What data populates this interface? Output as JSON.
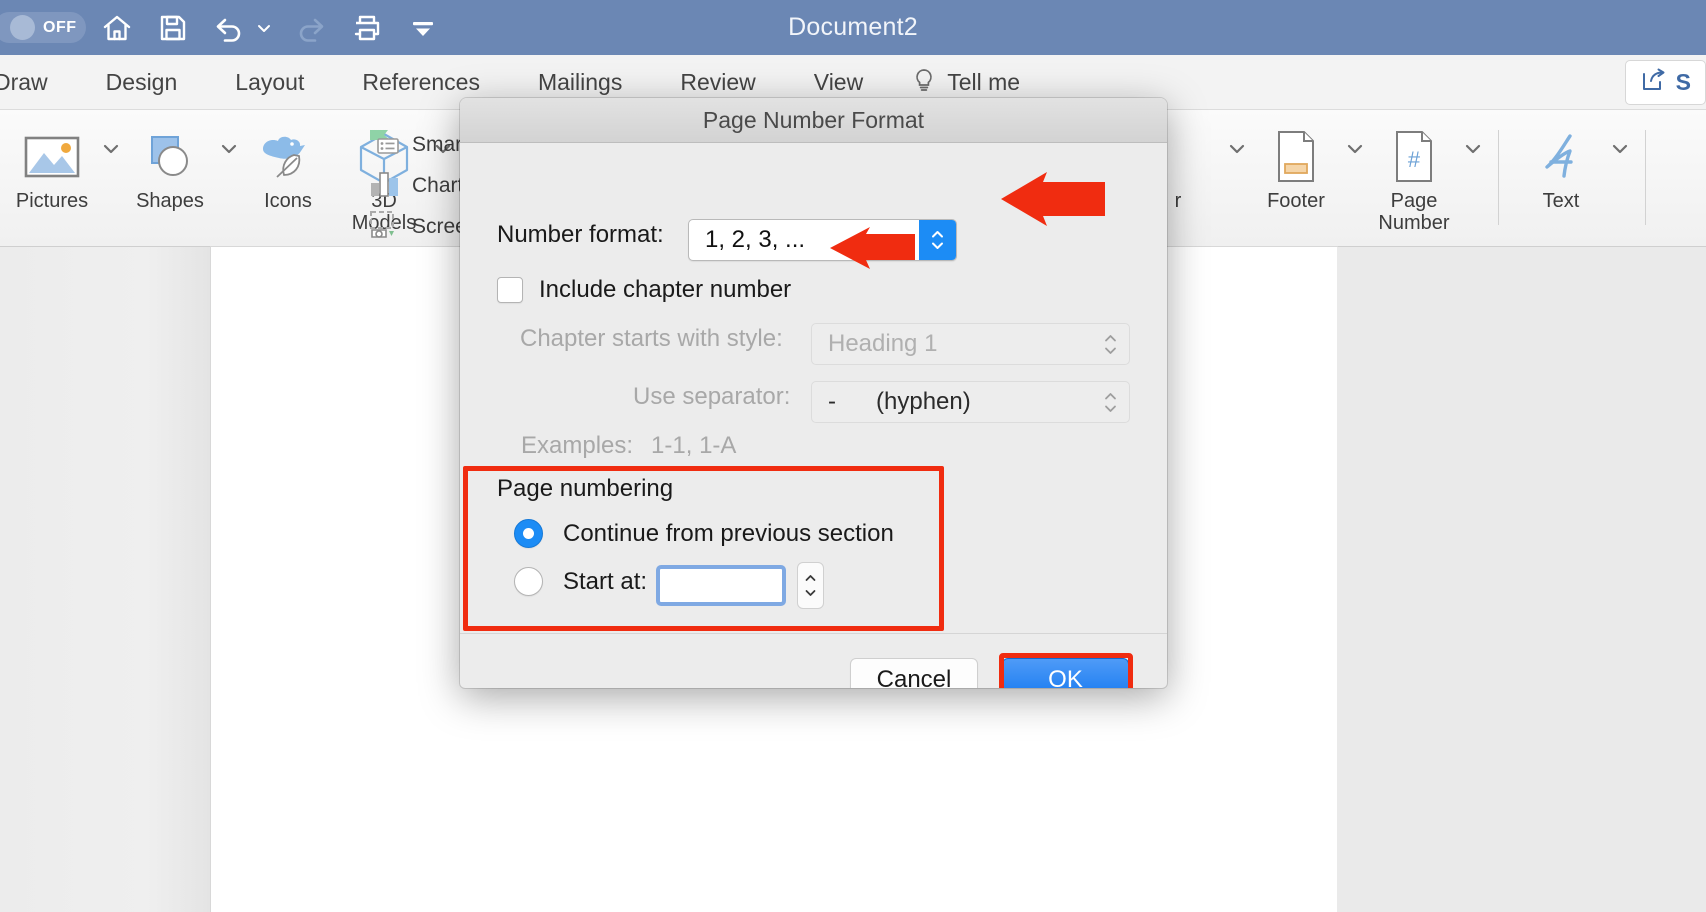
{
  "titlebar": {
    "toggle_label": "OFF",
    "document_title": "Document2",
    "icons": [
      "home-icon",
      "save-icon",
      "undo-icon",
      "undo-dropdown-caret",
      "redo-icon",
      "print-icon",
      "customize-toolbar-icon"
    ]
  },
  "ribbon_tabs": [
    {
      "label": "Draw"
    },
    {
      "label": "Design"
    },
    {
      "label": "Layout"
    },
    {
      "label": "References"
    },
    {
      "label": "Mailings"
    },
    {
      "label": "Review"
    },
    {
      "label": "View"
    }
  ],
  "tellme": {
    "label": "Tell me",
    "icon": "lightbulb-icon"
  },
  "share": {
    "label": "S",
    "icon": "share-icon"
  },
  "ribbon": {
    "illustrations": [
      {
        "label": "Pictures",
        "icon": "pictures-icon",
        "has_caret": true
      },
      {
        "label": "Shapes",
        "icon": "shapes-icon",
        "has_caret": true
      },
      {
        "label": "Icons",
        "icon": "icons-icon",
        "has_caret": false
      },
      {
        "label": "3D\nModels",
        "label_line1": "3D",
        "label_line2": "Models",
        "icon": "3d-models-icon",
        "has_caret": true
      }
    ],
    "list_items": [
      {
        "label": "Smart",
        "icon": "smartart-icon"
      },
      {
        "label": "Chart",
        "icon": "chart-icon"
      },
      {
        "label": "Scree",
        "icon": "screenshot-icon"
      }
    ],
    "header_footer": [
      {
        "label": "r",
        "icon": "header-icon",
        "has_caret": true
      },
      {
        "label": "Footer",
        "icon": "footer-icon",
        "has_caret": true
      },
      {
        "label_line1": "Page",
        "label_line2": "Number",
        "icon": "page-number-icon",
        "has_caret": true
      }
    ],
    "text_group": [
      {
        "label": "Text",
        "icon": "text-box-icon",
        "has_caret": true
      }
    ]
  },
  "dialog": {
    "title": "Page Number Format",
    "number_format": {
      "label": "Number format:",
      "value": "1, 2, 3, ...",
      "enabled": true
    },
    "include_chapter": {
      "label": "Include chapter number",
      "checked": false
    },
    "chapter_style": {
      "label": "Chapter starts with style:",
      "value": "Heading 1",
      "enabled": false
    },
    "separator": {
      "label": "Use separator:",
      "value": "-      (hyphen)",
      "enabled": false
    },
    "examples": {
      "label": "Examples:",
      "value": "1-1, 1-A"
    },
    "page_numbering": {
      "group_label": "Page numbering",
      "continue_option": {
        "label": "Continue from previous section",
        "selected": true
      },
      "start_at_option": {
        "label": "Start at:",
        "selected": false,
        "value": "",
        "placeholder": ""
      }
    },
    "buttons": {
      "cancel": "Cancel",
      "ok": "OK"
    }
  },
  "annotations": {
    "highlight_color": "#f02c10",
    "arrow_color": "#f02c10",
    "arrows": [
      {
        "name": "arrow-to-number-format-stepper"
      },
      {
        "name": "arrow-to-include-chapter-checkbox"
      }
    ],
    "boxes": [
      {
        "name": "highlight-page-numbering-group"
      },
      {
        "name": "highlight-ok-button"
      }
    ]
  },
  "colors": {
    "titlebar": "#6b87b4",
    "accent_blue": "#1c8cf5",
    "annotation_red": "#f02c10",
    "ribbon_bg": "#f3f3f3",
    "dialog_bg": "#ececec"
  }
}
